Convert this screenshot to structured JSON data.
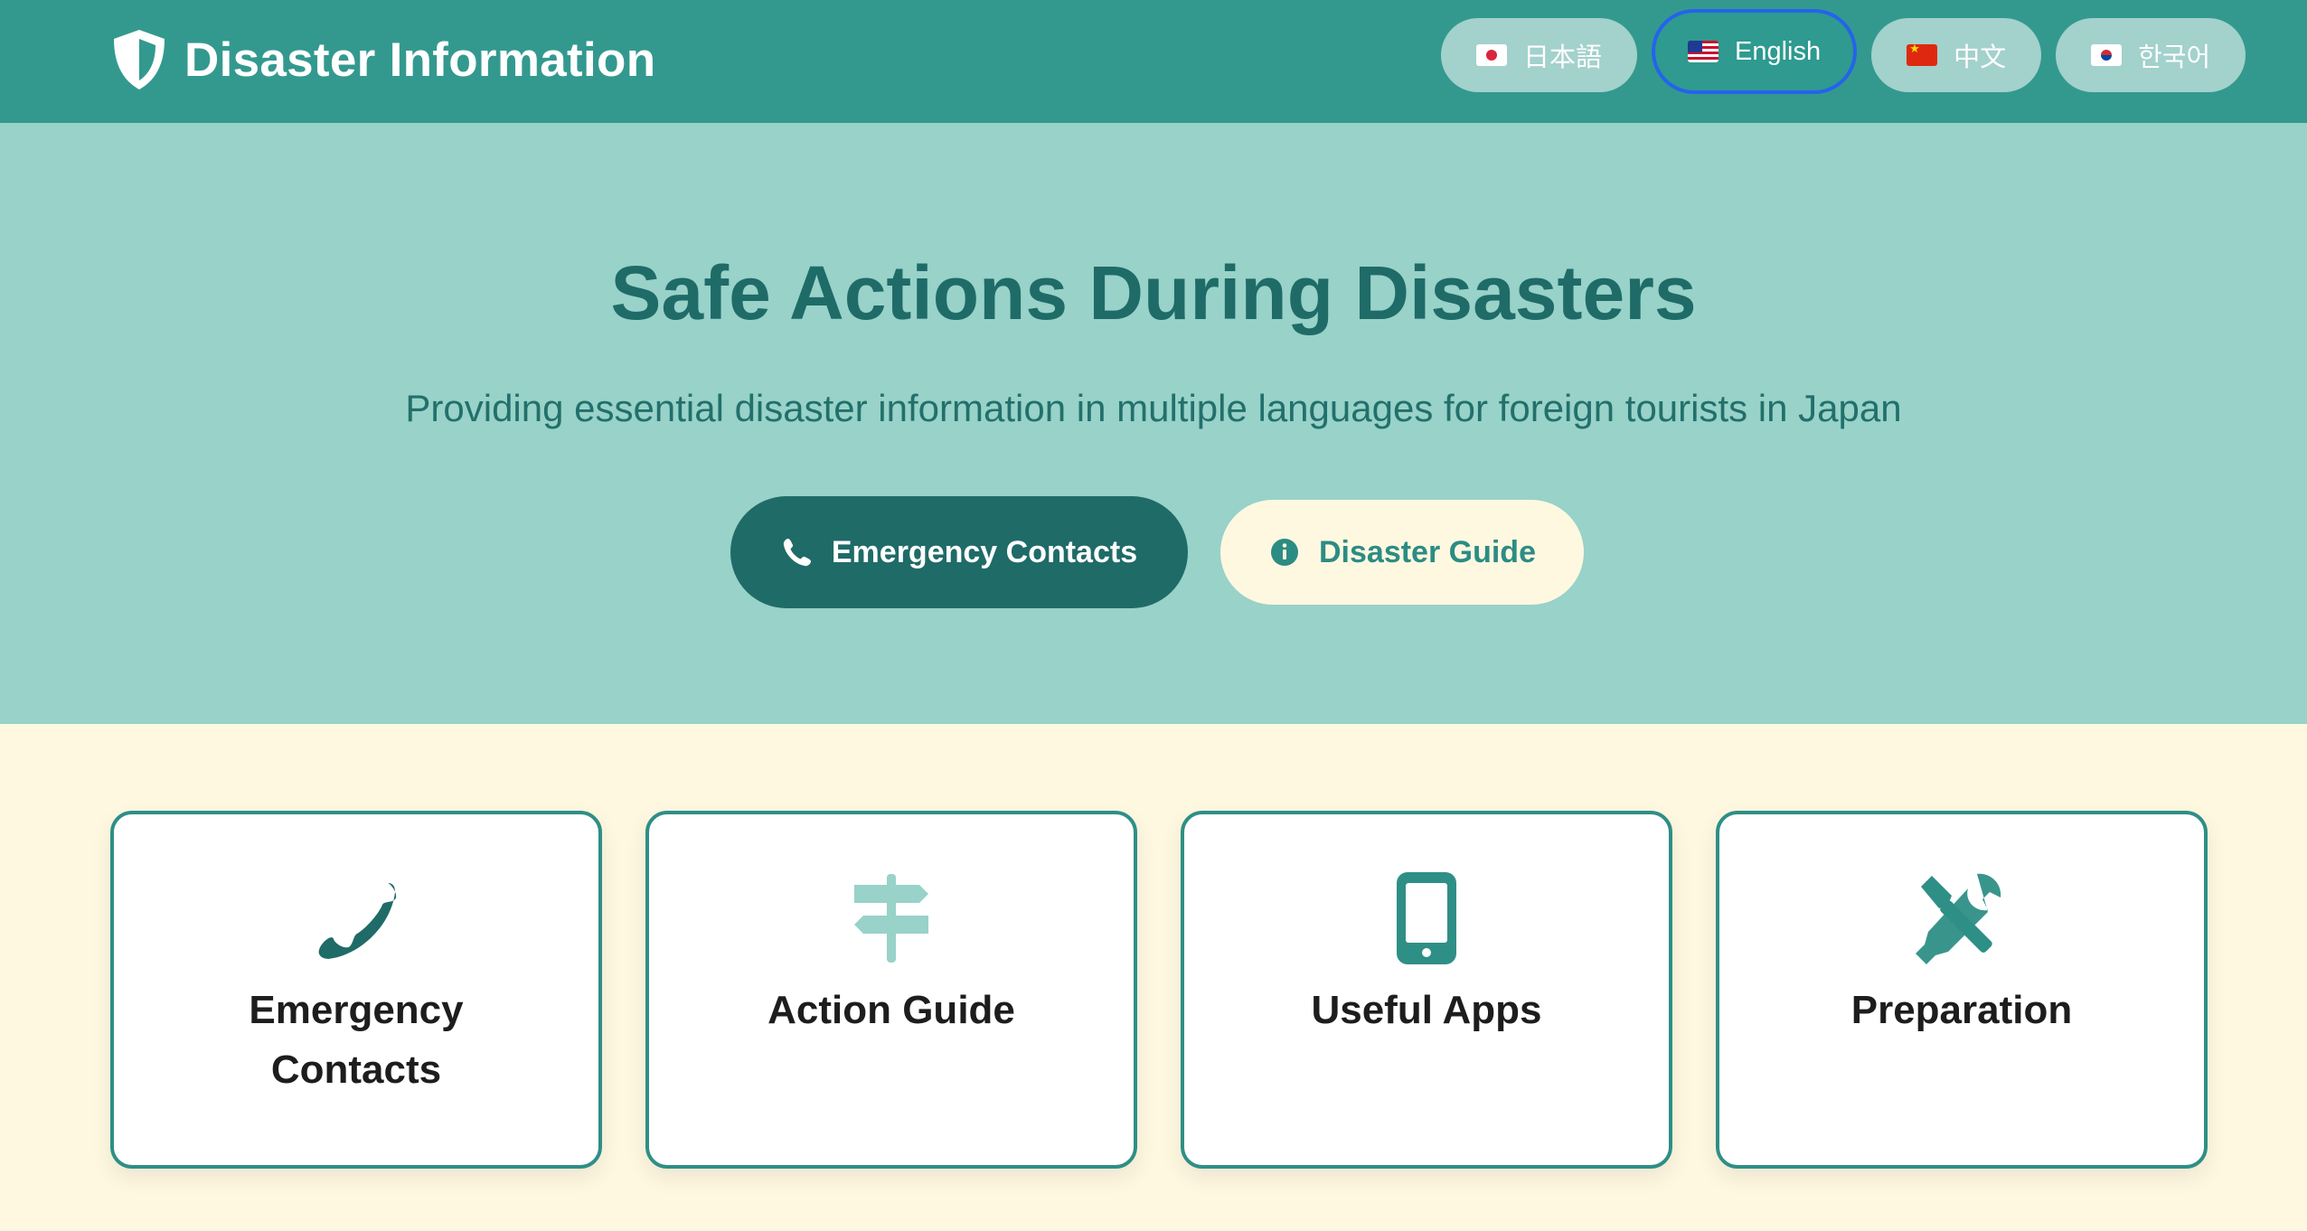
{
  "header": {
    "brand_title": "Disaster Information",
    "brand_icon": "shield-icon",
    "languages": [
      {
        "label": "日本語",
        "flag": "japan-flag-icon",
        "active": false
      },
      {
        "label": "English",
        "flag": "us-flag-icon",
        "active": true
      },
      {
        "label": "中文",
        "flag": "china-flag-icon",
        "active": false
      },
      {
        "label": "한국어",
        "flag": "korea-flag-icon",
        "active": false
      }
    ]
  },
  "hero": {
    "title": "Safe Actions During Disasters",
    "subtitle": "Providing essential disaster information in multiple languages for foreign tourists in Japan",
    "primary_button": {
      "label": "Emergency Contacts",
      "icon": "phone-icon"
    },
    "secondary_button": {
      "label": "Disaster Guide",
      "icon": "info-circle-icon"
    }
  },
  "cards": [
    {
      "title": "Emergency Contacts",
      "icon": "phone-icon"
    },
    {
      "title": "Action Guide",
      "icon": "signpost-icon"
    },
    {
      "title": "Useful Apps",
      "icon": "mobile-phone-icon"
    },
    {
      "title": "Preparation",
      "icon": "tools-icon"
    }
  ],
  "colors": {
    "header_bg": "#33998F",
    "hero_bg": "#98D2C9",
    "page_bg": "#FFF8E1",
    "primary_dark": "#1F6B68",
    "accent_teal": "#2E8F86",
    "active_outline": "#2563EB"
  }
}
